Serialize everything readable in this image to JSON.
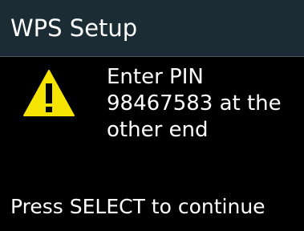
{
  "header": {
    "title": "WPS Setup"
  },
  "dialog": {
    "icon": "warning-icon",
    "message_lines": [
      "Enter PIN",
      "98467583 at the",
      "other end"
    ]
  },
  "footer": {
    "prompt": "Press SELECT to continue"
  },
  "colors": {
    "background": "#000000",
    "header_background": "#1b2c35",
    "warning_yellow": "#f5e400",
    "text": "#ffffff"
  }
}
